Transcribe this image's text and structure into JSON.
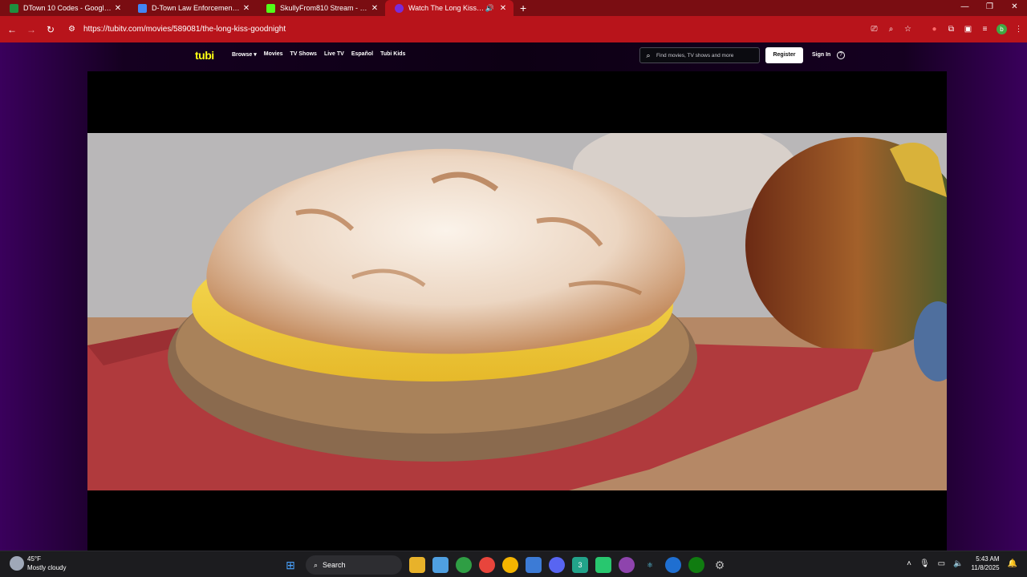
{
  "browser": {
    "tabs": [
      {
        "title": "DTown 10 Codes - Google Sheets",
        "color": "#1e8e3e",
        "active": false
      },
      {
        "title": "D-Town Law Enforcement SOP",
        "color": "#4285f4",
        "active": false
      },
      {
        "title": "SkullyFrom810 Stream - Watch",
        "color": "#53fc18",
        "active": false
      },
      {
        "title": "Watch The Long Kiss Goodnight",
        "color": "#7a2bd8",
        "active": true
      }
    ],
    "url": "https://tubitv.com/movies/589081/the-long-kiss-goodnight"
  },
  "tubi": {
    "logo": "tubi",
    "nav": [
      "Browse ▾",
      "Movies",
      "TV Shows",
      "Live TV",
      "Español",
      "Tubi Kids"
    ],
    "search_placeholder": "Find movies, TV shows and more",
    "register_label": "Register",
    "signin_label": "Sign In"
  },
  "taskbar": {
    "temperature": "45°F",
    "condition": "Mostly cloudy",
    "search_label": "Search",
    "time": "5:43 AM",
    "date": "11/8/2025"
  },
  "colors": {
    "browser_accent": "#b8141b",
    "tubi_logo": "#ffff13"
  }
}
